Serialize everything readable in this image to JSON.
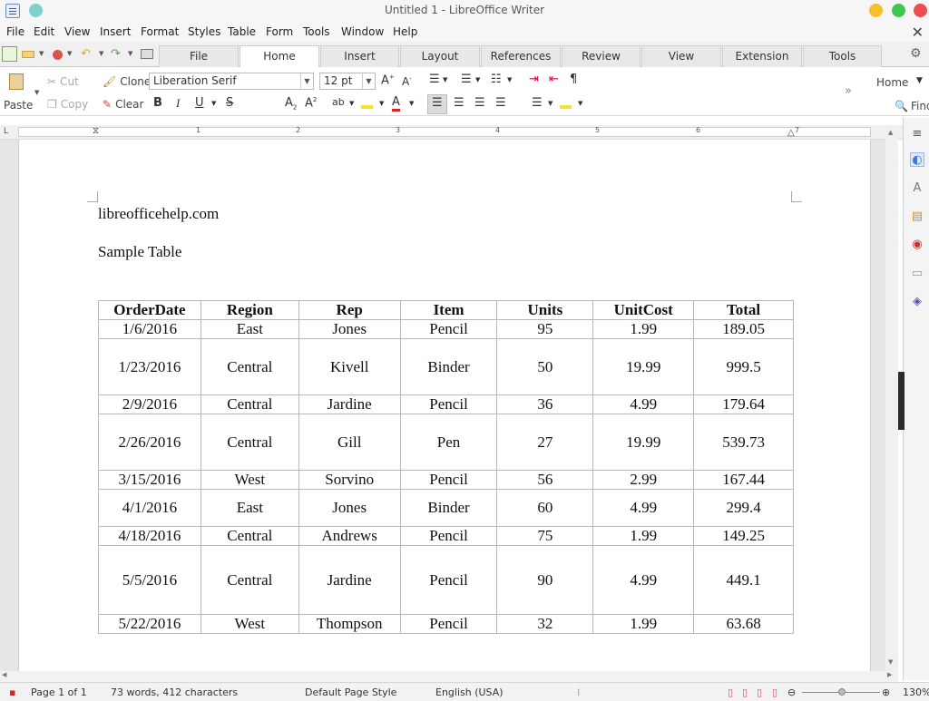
{
  "window": {
    "title": "Untitled 1 - LibreOffice Writer"
  },
  "menu": [
    "File",
    "Edit",
    "View",
    "Insert",
    "Format",
    "Styles",
    "Table",
    "Form",
    "Tools",
    "Window",
    "Help"
  ],
  "tabs": [
    "File",
    "Home",
    "Insert",
    "Layout",
    "References",
    "Review",
    "View",
    "Extension",
    "Tools"
  ],
  "toolbar": {
    "paste": "Paste",
    "cut": "Cut",
    "copy": "Copy",
    "clone": "Clone",
    "clear": "Clear",
    "font_name": "Liberation Serif",
    "font_size": "12 pt",
    "home_dropdown": "Home",
    "find": "Find"
  },
  "ruler": [
    "1",
    "2",
    "3",
    "4",
    "5",
    "6",
    "7"
  ],
  "document": {
    "line1": "libreofficehelp.com",
    "line2": "Sample Table",
    "table": {
      "headers": [
        "OrderDate",
        "Region",
        "Rep",
        "Item",
        "Units",
        "UnitCost",
        "Total"
      ],
      "rows": [
        [
          "1/6/2016",
          "East",
          "Jones",
          "Pencil",
          "95",
          "1.99",
          "189.05"
        ],
        [
          "1/23/2016",
          "Central",
          "Kivell",
          "Binder",
          "50",
          "19.99",
          "999.5"
        ],
        [
          "2/9/2016",
          "Central",
          "Jardine",
          "Pencil",
          "36",
          "4.99",
          "179.64"
        ],
        [
          "2/26/2016",
          "Central",
          "Gill",
          "Pen",
          "27",
          "19.99",
          "539.73"
        ],
        [
          "3/15/2016",
          "West",
          "Sorvino",
          "Pencil",
          "56",
          "2.99",
          "167.44"
        ],
        [
          "4/1/2016",
          "East",
          "Jones",
          "Binder",
          "60",
          "4.99",
          "299.4"
        ],
        [
          "4/18/2016",
          "Central",
          "Andrews",
          "Pencil",
          "75",
          "1.99",
          "149.25"
        ],
        [
          "5/5/2016",
          "Central",
          "Jardine",
          "Pencil",
          "90",
          "4.99",
          "449.1"
        ],
        [
          "5/22/2016",
          "West",
          "Thompson",
          "Pencil",
          "32",
          "1.99",
          "63.68"
        ]
      ]
    }
  },
  "status": {
    "page": "Page 1 of 1",
    "words": "73 words, 412 characters",
    "style": "Default Page Style",
    "language": "English (USA)",
    "zoom": "130%"
  },
  "colors": {
    "minimize": "#f5c02f",
    "maximize": "#3ec74f",
    "close": "#ed4d4d",
    "accent": "#3d7ad6"
  }
}
